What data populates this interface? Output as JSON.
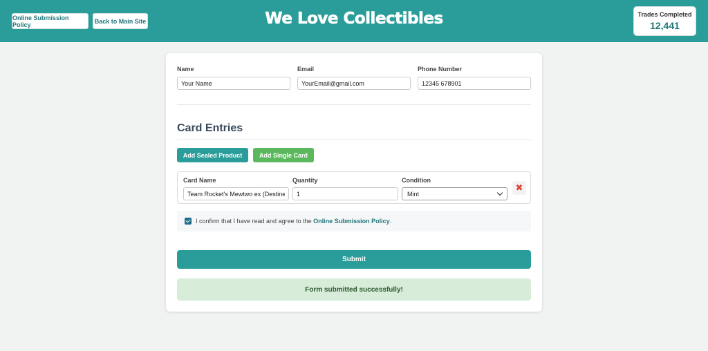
{
  "header": {
    "policy_button": "Online Submission Policy",
    "main_site_button": "Back to Main Site",
    "title": "We Love Collectibles",
    "trades_label": "Trades Completed",
    "trades_value": "12,441"
  },
  "contact": {
    "name_label": "Name",
    "name_value": "Your Name",
    "email_label": "Email",
    "email_value": "YourEmail@gmail.com",
    "phone_label": "Phone Number",
    "phone_value": "12345 678901"
  },
  "entries": {
    "title": "Card Entries",
    "add_sealed": "Add Sealed Product",
    "add_single": "Add Single Card",
    "card_name_label": "Card Name",
    "card_name_value": "Team Rocket's Mewtwo ex (Destined R",
    "quantity_label": "Quantity",
    "quantity_value": "1",
    "condition_label": "Condition",
    "condition_value": "Mint",
    "remove_icon": "close-icon"
  },
  "confirm": {
    "checked": true,
    "text_before": "I confirm that I have read and agree to the ",
    "link": "Online Submission Policy",
    "text_after": "."
  },
  "submit_label": "Submit",
  "success_message": "Form submitted successfully!",
  "colors": {
    "primary": "#2a9d9a",
    "green": "#5cb85c",
    "success_bg": "#d7ecd9",
    "remove_red": "#e0413a"
  }
}
